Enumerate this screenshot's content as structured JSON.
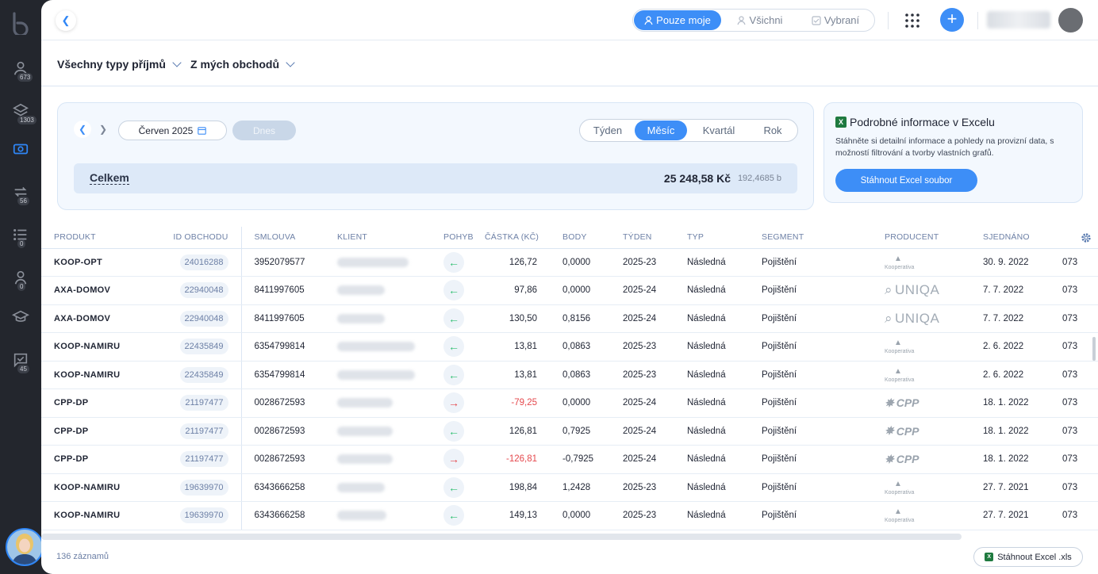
{
  "sidebar": {
    "items": [
      {
        "icon": "user-icon",
        "badge": "673"
      },
      {
        "icon": "layers-icon",
        "badge": "1303"
      },
      {
        "icon": "money-icon",
        "badge": ""
      },
      {
        "icon": "repeat-icon",
        "badge": "56"
      },
      {
        "icon": "list-icon",
        "badge": "0"
      },
      {
        "icon": "person-icon",
        "badge": "0"
      },
      {
        "icon": "graduation-icon",
        "badge": ""
      },
      {
        "icon": "chat-check-icon",
        "badge": "45"
      }
    ]
  },
  "header": {
    "scope_tabs": [
      {
        "label": "Pouze moje",
        "active": true
      },
      {
        "label": "Všichni",
        "active": false
      },
      {
        "label": "Vybraní",
        "active": false
      }
    ]
  },
  "filters": {
    "income_type": "Všechny typy příjmů",
    "source": "Z mých obchodů"
  },
  "period": {
    "month": "Červen 2025",
    "today": "Dnes",
    "ranges": [
      {
        "label": "Týden",
        "active": false
      },
      {
        "label": "Měsíc",
        "active": true
      },
      {
        "label": "Kvartál",
        "active": false
      },
      {
        "label": "Rok",
        "active": false
      }
    ],
    "total_label": "Celkem",
    "total_amount": "25 248,58 Kč",
    "total_points": "192,4685 b"
  },
  "excel": {
    "title": "Podrobné informace v Excelu",
    "description": "Stáhněte si detailní informace a pohledy na provizní data, s možností filtrování a tvorby vlastních grafů.",
    "button": "Stáhnout Excel soubor"
  },
  "table": {
    "headers": [
      "PRODUKT",
      "ID OBCHODU",
      "SMLOUVA",
      "KLIENT",
      "POHYB",
      "ČÁSTKA (KČ)",
      "BODY",
      "TÝDEN",
      "TYP",
      "SEGMENT",
      "PRODUCENT",
      "SJEDNÁNO"
    ],
    "rows": [
      {
        "produkt": "KOOP-OPT",
        "id": "24016288",
        "smlouva": "3952079577",
        "pohyb": "in",
        "castka": "126,72",
        "body": "0,0000",
        "tyden": "2025-23",
        "typ": "Následná",
        "segment": "Pojištění",
        "producent": "Kooperativa",
        "sjednano": "30. 9. 2022",
        "extra": "073"
      },
      {
        "produkt": "AXA-DOMOV",
        "id": "22940048",
        "smlouva": "8411997605",
        "pohyb": "in",
        "castka": "97,86",
        "body": "0,0000",
        "tyden": "2025-24",
        "typ": "Následná",
        "segment": "Pojištění",
        "producent": "UNIQA",
        "sjednano": "7. 7. 2022",
        "extra": "073"
      },
      {
        "produkt": "AXA-DOMOV",
        "id": "22940048",
        "smlouva": "8411997605",
        "pohyb": "in",
        "castka": "130,50",
        "body": "0,8156",
        "tyden": "2025-24",
        "typ": "Následná",
        "segment": "Pojištění",
        "producent": "UNIQA",
        "sjednano": "7. 7. 2022",
        "extra": "073"
      },
      {
        "produkt": "KOOP-NAMIRU",
        "id": "22435849",
        "smlouva": "6354799814",
        "pohyb": "in",
        "castka": "13,81",
        "body": "0,0863",
        "tyden": "2025-23",
        "typ": "Následná",
        "segment": "Pojištění",
        "producent": "Kooperativa",
        "sjednano": "2. 6. 2022",
        "extra": "073"
      },
      {
        "produkt": "KOOP-NAMIRU",
        "id": "22435849",
        "smlouva": "6354799814",
        "pohyb": "in",
        "castka": "13,81",
        "body": "0,0863",
        "tyden": "2025-23",
        "typ": "Následná",
        "segment": "Pojištění",
        "producent": "Kooperativa",
        "sjednano": "2. 6. 2022",
        "extra": "073"
      },
      {
        "produkt": "CPP-DP",
        "id": "21197477",
        "smlouva": "0028672593",
        "pohyb": "out",
        "castka": "-79,25",
        "body": "0,0000",
        "tyden": "2025-24",
        "typ": "Následná",
        "segment": "Pojištění",
        "producent": "CPP",
        "sjednano": "18. 1. 2022",
        "extra": "073"
      },
      {
        "produkt": "CPP-DP",
        "id": "21197477",
        "smlouva": "0028672593",
        "pohyb": "in",
        "castka": "126,81",
        "body": "0,7925",
        "tyden": "2025-24",
        "typ": "Následná",
        "segment": "Pojištění",
        "producent": "CPP",
        "sjednano": "18. 1. 2022",
        "extra": "073"
      },
      {
        "produkt": "CPP-DP",
        "id": "21197477",
        "smlouva": "0028672593",
        "pohyb": "out",
        "castka": "-126,81",
        "body": "-0,7925",
        "tyden": "2025-24",
        "typ": "Následná",
        "segment": "Pojištění",
        "producent": "CPP",
        "sjednano": "18. 1. 2022",
        "extra": "073"
      },
      {
        "produkt": "KOOP-NAMIRU",
        "id": "19639970",
        "smlouva": "6343666258",
        "pohyb": "in",
        "castka": "198,84",
        "body": "1,2428",
        "tyden": "2025-23",
        "typ": "Následná",
        "segment": "Pojištění",
        "producent": "Kooperativa",
        "sjednano": "27. 7. 2021",
        "extra": "073"
      },
      {
        "produkt": "KOOP-NAMIRU",
        "id": "19639970",
        "smlouva": "6343666258",
        "pohyb": "in",
        "castka": "149,13",
        "body": "0,0000",
        "tyden": "2025-23",
        "typ": "Následná",
        "segment": "Pojištění",
        "producent": "Kooperativa",
        "sjednano": "27. 7. 2021",
        "extra": "073"
      }
    ]
  },
  "footer": {
    "count": "136 záznamů",
    "export_button": "Stáhnout Excel .xls"
  },
  "colors": {
    "accent": "#3d8ef7",
    "sidebar": "#23262d",
    "negative": "#e5484d",
    "positive": "#2fbf71"
  }
}
